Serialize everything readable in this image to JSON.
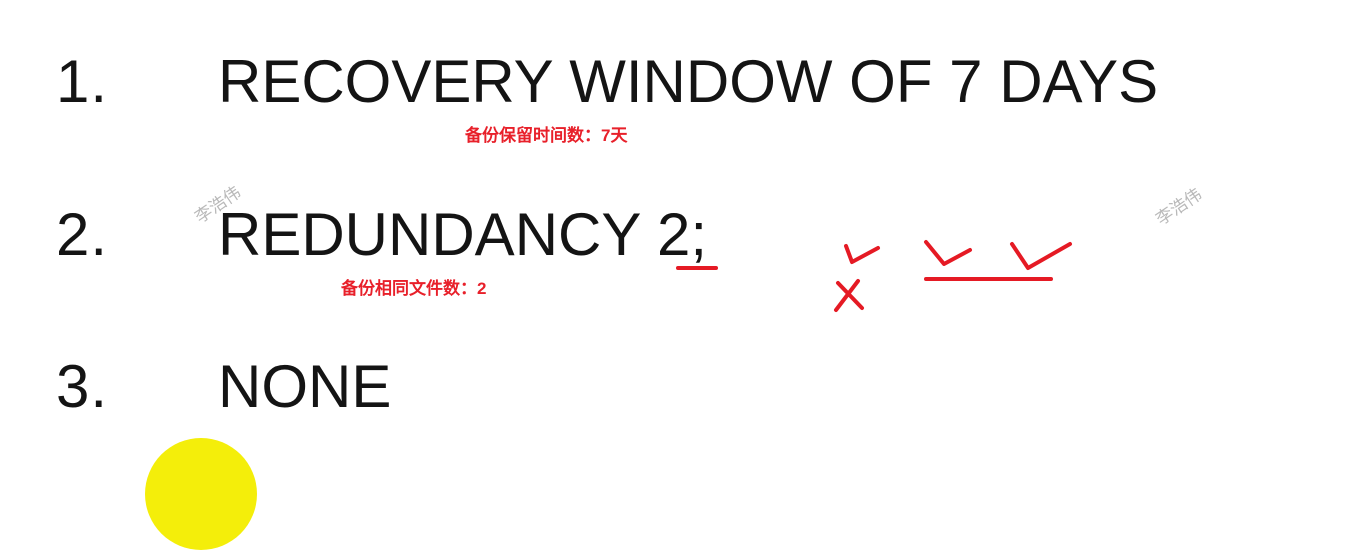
{
  "items": [
    {
      "number": "1.",
      "text": "RECOVERY WINDOW OF 7 DAYS",
      "note": "备份保留时间数：7天"
    },
    {
      "number": "2.",
      "text_before": "REDUNDANCY ",
      "text_highlight": "2",
      "text_after": ";",
      "note": "备份相同文件数：2"
    },
    {
      "number": "3.",
      "text": "NONE"
    }
  ],
  "watermarks": [
    "李浩伟",
    "李浩伟"
  ],
  "colors": {
    "text": "#141414",
    "annotation": "#e8202a",
    "pointer": "#f4ee0a",
    "watermark": "#b9b9b9"
  }
}
